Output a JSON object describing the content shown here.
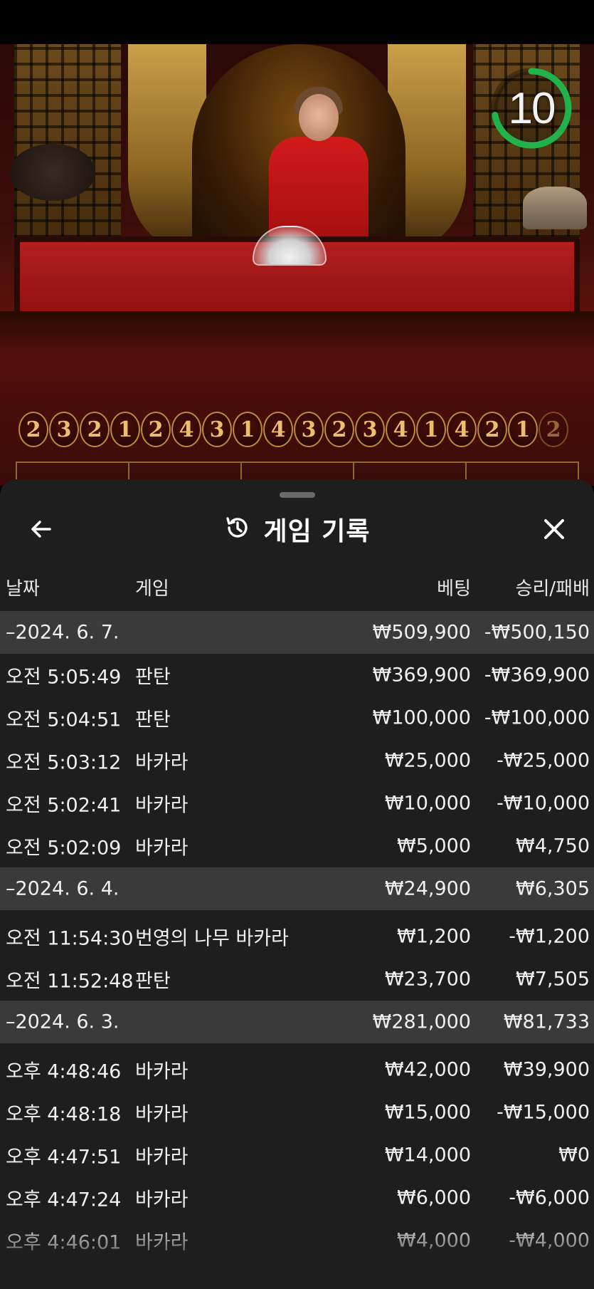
{
  "timer": {
    "value": "10",
    "progress": 0.72,
    "color": "#22b24c"
  },
  "roadmap": {
    "beads": [
      "2",
      "3",
      "2",
      "1",
      "2",
      "4",
      "3",
      "1",
      "4",
      "3",
      "2",
      "3",
      "4",
      "1",
      "4",
      "2",
      "1",
      "2"
    ]
  },
  "sheet": {
    "title": "게임 기록",
    "icons": {
      "back": "arrow-left-icon",
      "title": "history-icon",
      "close": "close-icon"
    },
    "columns": {
      "date": "날짜",
      "game": "게임",
      "bet": "베팅",
      "result": "승리/패배"
    },
    "groups": [
      {
        "date": "–2024. 6. 7.",
        "bet": "₩509,900",
        "result": "-₩500,150",
        "rows": [
          {
            "time": "오전 5:05:49",
            "game": "판탄",
            "bet": "₩369,900",
            "result": "-₩369,900"
          },
          {
            "time": "오전 5:04:51",
            "game": "판탄",
            "bet": "₩100,000",
            "result": "-₩100,000"
          },
          {
            "time": "오전 5:03:12",
            "game": "바카라",
            "bet": "₩25,000",
            "result": "-₩25,000"
          },
          {
            "time": "오전 5:02:41",
            "game": "바카라",
            "bet": "₩10,000",
            "result": "-₩10,000"
          },
          {
            "time": "오전 5:02:09",
            "game": "바카라",
            "bet": "₩5,000",
            "result": "₩4,750"
          }
        ]
      },
      {
        "date": "–2024. 6. 4.",
        "bet": "₩24,900",
        "result": "₩6,305",
        "rows": [
          {
            "time": "오전 11:54:30",
            "game": "번영의 나무 바카라",
            "bet": "₩1,200",
            "result": "-₩1,200"
          },
          {
            "time": "오전 11:52:48",
            "game": "판탄",
            "bet": "₩23,700",
            "result": "₩7,505"
          }
        ]
      },
      {
        "date": "–2024. 6. 3.",
        "bet": "₩281,000",
        "result": "₩81,733",
        "rows": [
          {
            "time": "오후 4:48:46",
            "game": "바카라",
            "bet": "₩42,000",
            "result": "₩39,900"
          },
          {
            "time": "오후 4:48:18",
            "game": "바카라",
            "bet": "₩15,000",
            "result": "-₩15,000"
          },
          {
            "time": "오후 4:47:51",
            "game": "바카라",
            "bet": "₩14,000",
            "result": "₩0"
          },
          {
            "time": "오후 4:47:24",
            "game": "바카라",
            "bet": "₩6,000",
            "result": "-₩6,000"
          },
          {
            "time": "오후 4:46:01",
            "game": "바카라",
            "bet": "₩4,000",
            "result": "-₩4,000"
          }
        ]
      }
    ]
  }
}
